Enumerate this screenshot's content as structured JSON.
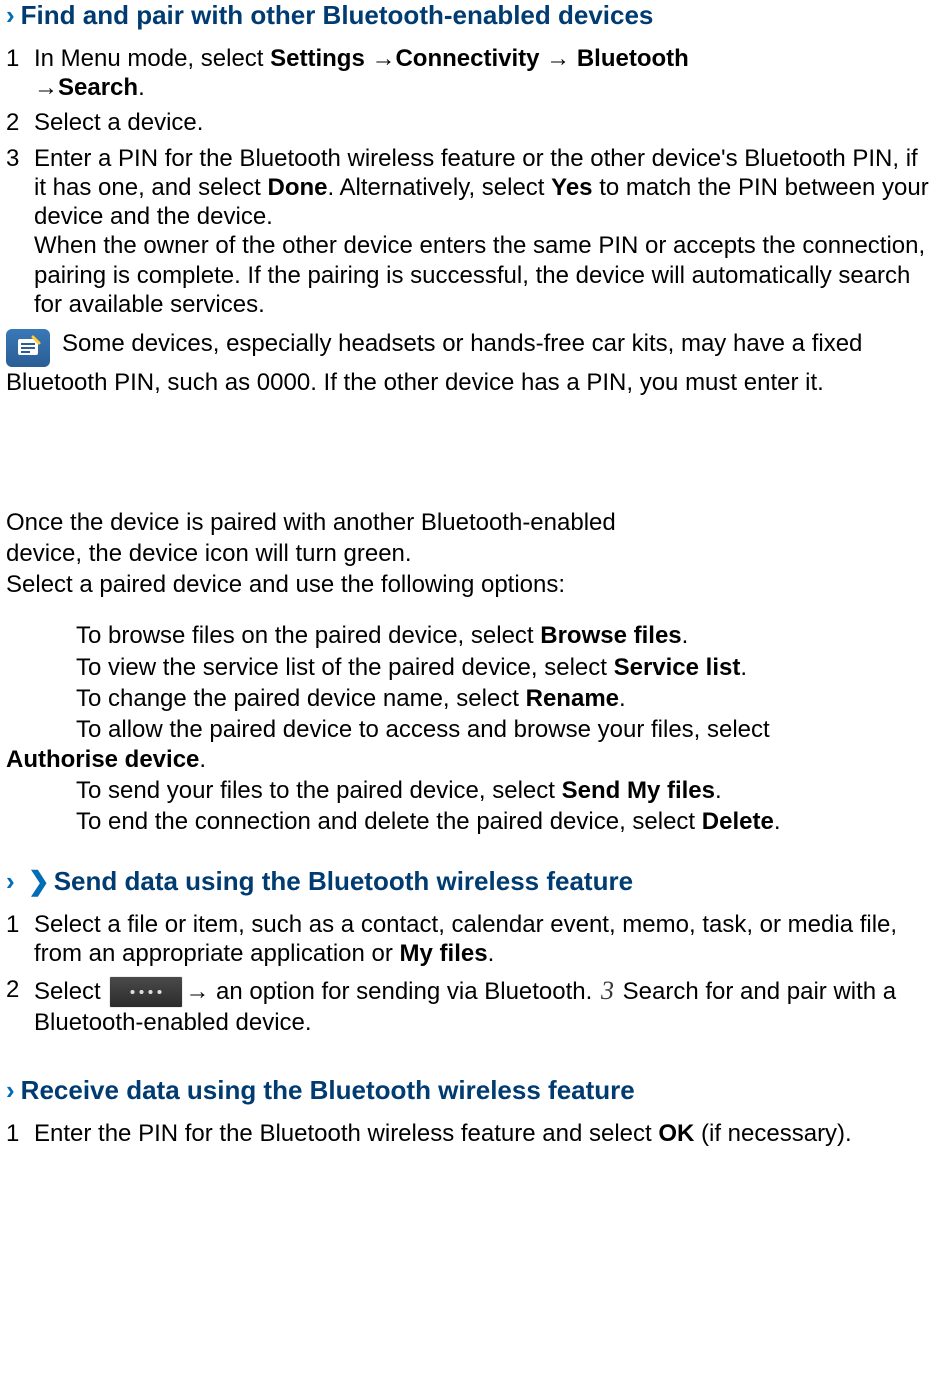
{
  "s1": {
    "chevron": "›",
    "title": "Find and pair with other Bluetooth-enabled devices",
    "steps": {
      "n1": "1",
      "t1a": "In Menu mode, select ",
      "t1b": "Settings ",
      "t1arrow1": "→",
      "t1c": "Connectivity ",
      "t1arrow2": "→",
      "t1d": " Bluetooth ",
      "t1arrow3": "→",
      "t1e": "Search",
      "t1f": ".",
      "n2": "2",
      "t2": "Select a device.",
      "n3": "3",
      "t3a": "Enter a PIN for the Bluetooth wireless feature or the other device's Bluetooth PIN, if it has one, and select ",
      "t3b": "Done",
      "t3c": ". Alternatively, select ",
      "t3d": "Yes",
      "t3e": " to match the PIN between your device and the device.",
      "t3f": "When the owner of the other device enters the same PIN or accepts the connection, pairing is complete. If the pairing is successful, the device will automatically search for available services."
    },
    "note": "Some devices, especially headsets or hands-free car kits, may have a fixed Bluetooth PIN, such as 0000. If the other device has a PIN, you must enter it."
  },
  "mid": {
    "p1": "Once the device is paired with another Bluetooth-enabled",
    "p2": "device, the device icon will turn green.",
    "p3": "Select a paired device and use the following options:",
    "opts": {
      "o1a": "To browse files on the paired device, select ",
      "o1b": "Browse files",
      "o1c": ".",
      "o2a": "To view the service list of the paired device, select ",
      "o2b": "Service list",
      "o2c": ".",
      "o3a": "To change the paired device name, select ",
      "o3b": "Rename",
      "o3c": ".",
      "o4a": "To allow the paired device to access and browse your files, select ",
      "o4b": "Authorise device",
      "o4c": ".",
      "o5a": "To send your files to the paired device, select ",
      "o5b": "Send My files",
      "o5c": ".",
      "o6a": "To end the connection and delete the paired device, select ",
      "o6b": "Delete",
      "o6c": "."
    }
  },
  "s2": {
    "chevron": "›",
    "bullet": "❯",
    "title": "Send data using the Bluetooth wireless feature",
    "n1": "1",
    "t1a": "Select a file or item, such as a contact, calendar event, memo, task, or media file, from an appropriate application or ",
    "t1b": "My files",
    "t1c": ".",
    "n2": "2",
    "t2a": "Select ",
    "t2arrow": "→",
    "t2b": " an option for sending via Bluetooth. ",
    "t2num": "3",
    "t2c": " Search for and pair with a Bluetooth-enabled device."
  },
  "s3": {
    "chevron": "›",
    "title": "Receive data using the Bluetooth wireless feature",
    "n1": "1",
    "t1a": "Enter the PIN for the Bluetooth wireless feature and select ",
    "t1b": "OK",
    "t1c": " (if necessary)."
  }
}
